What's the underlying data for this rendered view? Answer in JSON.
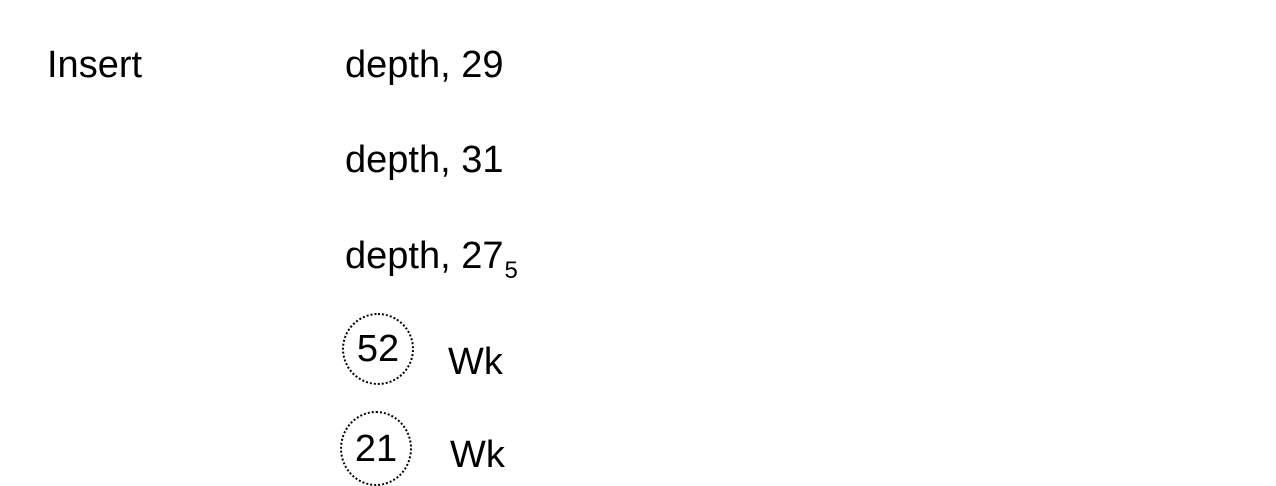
{
  "insert_label": "Insert",
  "depth_lines": [
    {
      "text": "depth, 29",
      "subscript": ""
    },
    {
      "text": "depth, 31",
      "subscript": ""
    },
    {
      "text": "depth, 27",
      "subscript": "5"
    }
  ],
  "circled_items": [
    {
      "number": "52",
      "label": "Wk"
    },
    {
      "number": "21",
      "label": "Wk"
    }
  ]
}
